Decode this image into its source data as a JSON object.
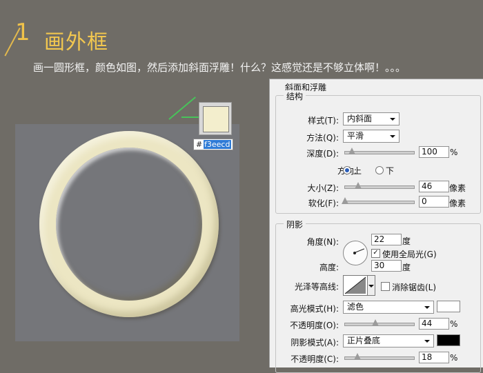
{
  "header": {
    "step_number": "1",
    "title": "画外框",
    "description": "画一圆形框，颜色如图，然后添加斜面浮雕！什么？这感觉还是不够立体啊！。。。"
  },
  "swatch": {
    "hash": "#",
    "hex": "f3eecd",
    "color": "#f3eecd"
  },
  "panel": {
    "title": "斜面和浮雕",
    "structure": {
      "label": "结构",
      "style_label": "样式(T):",
      "style_value": "内斜面",
      "method_label": "方法(Q):",
      "method_value": "平滑",
      "depth_label": "深度(D):",
      "depth_value": "100",
      "depth_unit": "%",
      "depth_fraction": 0.1,
      "direction_label": "方向:",
      "dir_up": "上",
      "dir_down": "下",
      "size_label": "大小(Z):",
      "size_value": "46",
      "size_unit": "像素",
      "size_fraction": 0.19,
      "soften_label": "软化(F):",
      "soften_value": "0",
      "soften_unit": "像素",
      "soften_fraction": 0.0
    },
    "shading": {
      "label": "阴影",
      "angle_label": "角度(N):",
      "angle_value": "22",
      "angle_unit": "度",
      "global_light_label": "使用全局光(G)",
      "altitude_label": "高度:",
      "altitude_value": "30",
      "altitude_unit": "度",
      "gloss_label": "光泽等高线:",
      "antialias_label": "消除锯齿(L)",
      "highlight_mode_label": "高光模式(H):",
      "highlight_mode_value": "滤色",
      "highlight_color": "#ffffff",
      "opacity1_label": "不透明度(O):",
      "opacity1_value": "44",
      "opacity1_unit": "%",
      "opacity1_fraction": 0.44,
      "shadow_mode_label": "阴影模式(A):",
      "shadow_mode_value": "正片叠底",
      "shadow_color": "#000000",
      "opacity2_label": "不透明度(C):",
      "opacity2_value": "18",
      "opacity2_unit": "%",
      "opacity2_fraction": 0.18
    }
  }
}
